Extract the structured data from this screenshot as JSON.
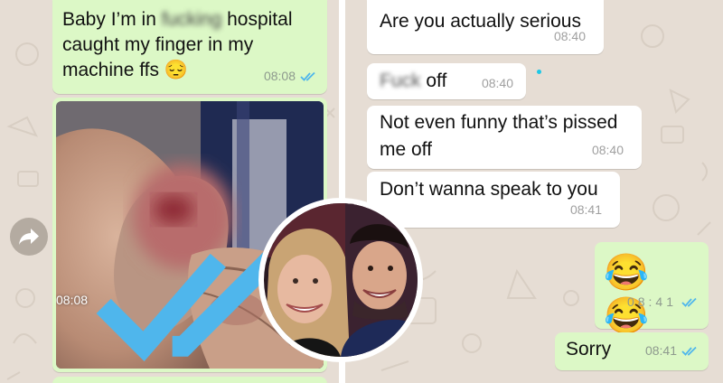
{
  "left_chat": {
    "msg_hospital": {
      "line1_pre": "Baby I’m in ",
      "line1_censored": "fucking",
      "line1_post": " hospital",
      "line2": "caught my finger in my",
      "line3": "machine ffs 😔",
      "time": "08:08",
      "status": "read"
    },
    "msg_photo": {
      "time": "08:08",
      "status": "read"
    }
  },
  "right_chat": {
    "messages": [
      {
        "text": "Are you actually serious",
        "time": "08:40",
        "direction": "incoming"
      },
      {
        "censored": "Fuck",
        "text": " off",
        "time": "08:40",
        "direction": "incoming"
      },
      {
        "line1": "Not even funny that’s pissed",
        "line2": "me off",
        "time": "08:40",
        "direction": "incoming"
      },
      {
        "text": "Don’t wanna speak to you",
        "time": "08:41",
        "direction": "incoming"
      },
      {
        "text": "😂 😂",
        "time": "08:41",
        "direction": "outgoing",
        "status": "read"
      },
      {
        "text": "Sorry",
        "time": "08:41",
        "direction": "outgoing",
        "status": "read"
      }
    ]
  },
  "colors": {
    "outgoing_bubble": "#dcf8c6",
    "incoming_bubble": "#ffffff",
    "chat_background": "#e6ddd4",
    "read_ticks": "#4fb6ec"
  },
  "icons": {
    "forward": "forward-arrow-icon",
    "read_status": "double-check-icon"
  }
}
